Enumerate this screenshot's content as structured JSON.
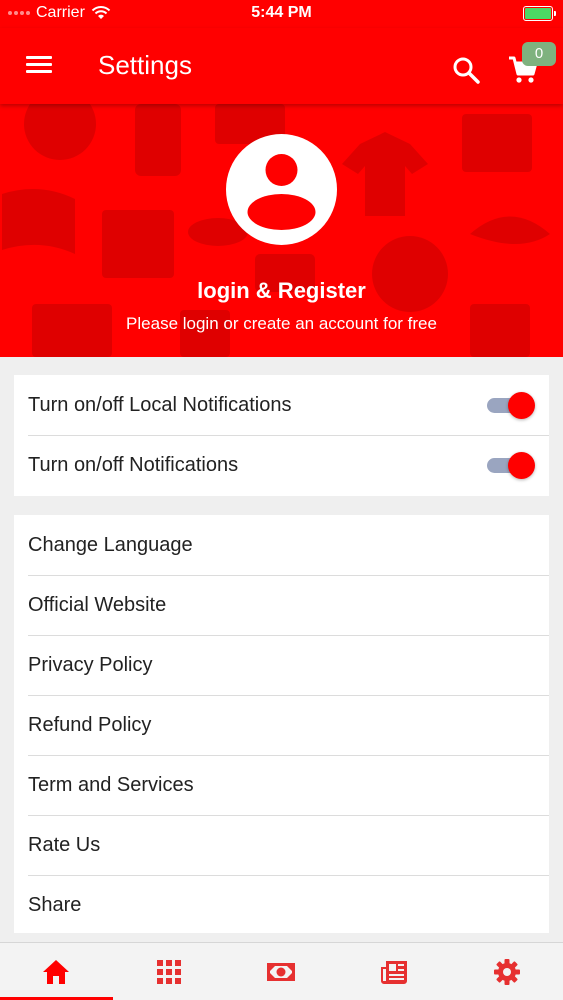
{
  "status_bar": {
    "carrier": "Carrier",
    "time": "5:44 PM"
  },
  "app_bar": {
    "title": "Settings",
    "cart_count": "0",
    "icons": [
      "menu-icon",
      "search-icon",
      "cart-icon"
    ]
  },
  "hero": {
    "title": "login & Register",
    "subtitle": "Please login or create an account for free"
  },
  "toggles": [
    {
      "label": "Turn on/off Local Notifications",
      "on": true
    },
    {
      "label": "Turn on/off Notifications",
      "on": true
    }
  ],
  "links": [
    {
      "label": "Change Language"
    },
    {
      "label": "Official Website"
    },
    {
      "label": "Privacy Policy"
    },
    {
      "label": "Refund Policy"
    },
    {
      "label": "Term and Services"
    },
    {
      "label": "Rate Us"
    },
    {
      "label": "Share"
    }
  ],
  "bottom_nav": [
    {
      "icon": "home-icon",
      "active": true
    },
    {
      "icon": "grid-icon",
      "active": false
    },
    {
      "icon": "money-icon",
      "active": false
    },
    {
      "icon": "news-icon",
      "active": false
    },
    {
      "icon": "gear-icon",
      "active": false
    }
  ],
  "colors": {
    "primary": "#ff0000",
    "toggle_track": "#9aa5c0",
    "badge": "#7fb27f"
  }
}
